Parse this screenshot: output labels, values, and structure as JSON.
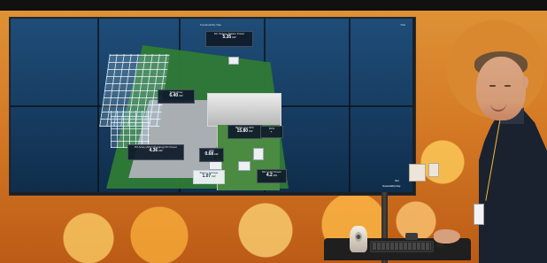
{
  "display": {
    "title": "Sustainability Map",
    "corner_label": "Visit"
  },
  "cards": {
    "dc_charge": {
      "label": "DC Charge Station Power",
      "value": "5.35",
      "unit": "kW"
    },
    "left_mid": {
      "label": "Solar Array",
      "value": "6.40",
      "unit": "kW"
    },
    "bess": {
      "label": "BESS and SPC",
      "value": "15.80",
      "unit": "kW"
    },
    "dcs": {
      "label": "DCS",
      "value": "-",
      "unit": ""
    },
    "pv_array": {
      "label": "PV Array (AFV Charging) DC Power",
      "value": "4.36",
      "unit": "kW"
    },
    "vpc": {
      "label": "VPC",
      "value": "0.68",
      "unit": "kW"
    },
    "battery_storage": {
      "label": "Battery Storage",
      "value": "1.07",
      "unit": "kW"
    },
    "bottom_right": {
      "label": "DC to AC Power",
      "value": "4.2",
      "unit": "kW"
    }
  },
  "room": {
    "labels": [
      "Visit",
      "Sustainability Map"
    ]
  }
}
